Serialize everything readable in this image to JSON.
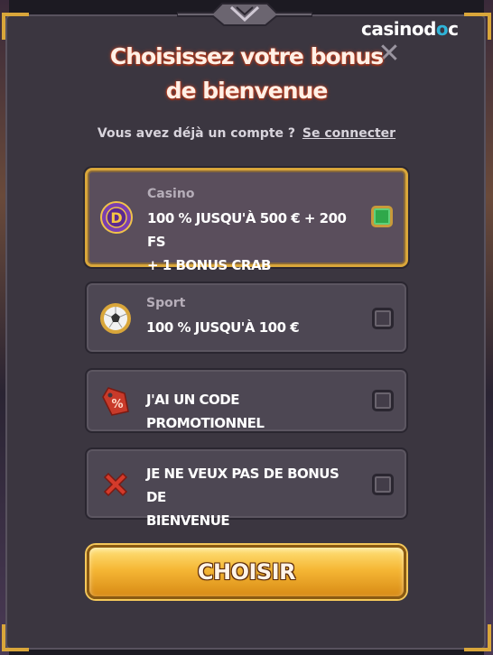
{
  "brand": {
    "logo_text_a": "casinod",
    "logo_text_b": "o",
    "logo_text_c": "c"
  },
  "title": {
    "line1": "Choisissez votre bonus",
    "line2": "de bienvenue"
  },
  "subtitle": {
    "text": "Vous avez déjà un compte ?",
    "link": "Se connecter"
  },
  "close_label": "✕",
  "options": [
    {
      "category": "Casino",
      "text_line1": "100 % JUSQU'À 500 € + 200 FS",
      "text_line2": "+ 1 BONUS CRAB",
      "selected": true,
      "icon": "casino-coin-icon"
    },
    {
      "category": "Sport",
      "text_line1": "100 % JUSQU'À 100 €",
      "text_line2": "",
      "selected": false,
      "icon": "soccer-ball-icon"
    },
    {
      "category": "",
      "text_line1": "J'AI UN CODE PROMOTIONNEL",
      "text_line2": "",
      "selected": false,
      "icon": "promo-tag-icon"
    },
    {
      "category": "",
      "text_line1": "JE NE VEUX PAS DE BONUS DE",
      "text_line2": "BIENVENUE",
      "selected": false,
      "icon": "red-x-icon"
    }
  ],
  "cta": {
    "label": "CHOISIR"
  },
  "colors": {
    "accent_gold": "#d9a63a",
    "panel": "#3b3640",
    "selected_check": "#2fa84a",
    "brand_blue": "#2fb4d8"
  }
}
